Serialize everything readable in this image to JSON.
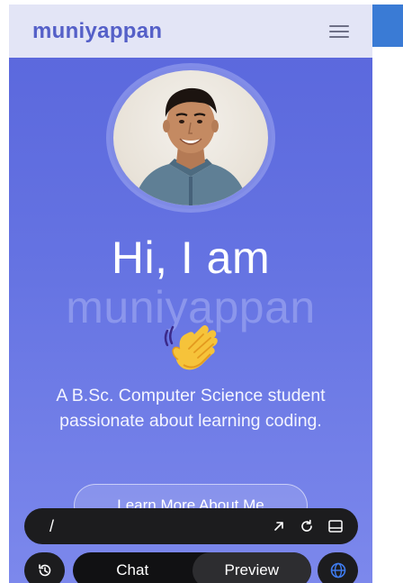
{
  "site": {
    "brand": "muniyappan",
    "hero": {
      "greeting": "Hi, I am",
      "name": "muniyappan",
      "emoji": "👋",
      "description": "A B.Sc. Computer Science student passionate about learning coding.",
      "cta_label": "Learn More About Me"
    },
    "colors": {
      "brand": "#5560c8",
      "hero_bg": "#5966dc",
      "name_accent": "#8b96ec"
    }
  },
  "browser": {
    "url_text": "/",
    "icons": {
      "open": "arrow-up-right-icon",
      "reload": "reload-icon",
      "panel": "panel-icon"
    }
  },
  "bottom_bar": {
    "history_icon": "history-icon",
    "tabs": [
      {
        "label": "Chat",
        "active": false
      },
      {
        "label": "Preview",
        "active": true
      }
    ],
    "globe_icon": "globe-icon"
  }
}
